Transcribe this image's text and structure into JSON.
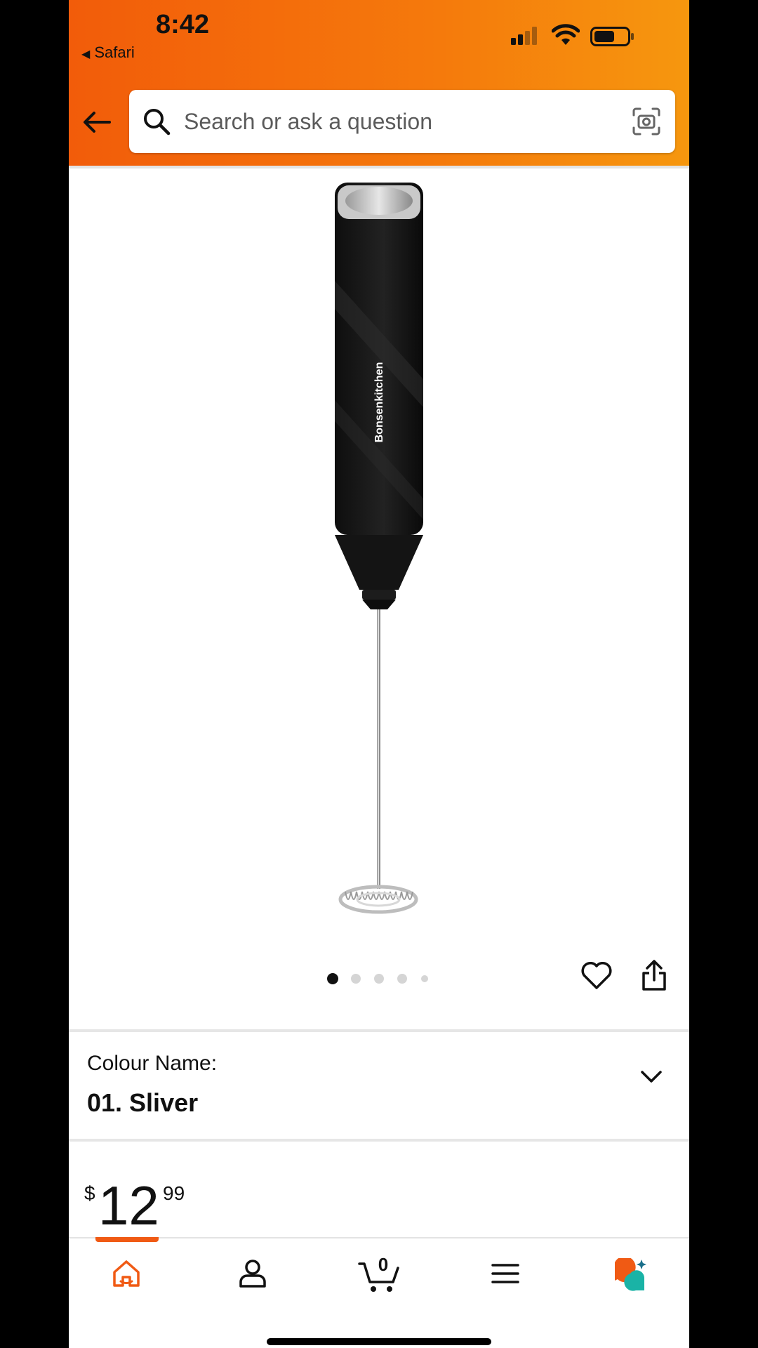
{
  "status_bar": {
    "time": "8:42",
    "back_app": "Safari"
  },
  "search": {
    "placeholder": "Search or ask a question"
  },
  "product": {
    "brand_print": "Bonsenkitchen"
  },
  "carousel": {
    "count": 5,
    "active_index": 0
  },
  "variant": {
    "label": "Colour Name:",
    "value": "01. Sliver"
  },
  "price": {
    "symbol": "$",
    "whole": "12",
    "fraction": "99"
  },
  "bottom_nav": {
    "items": [
      "home-icon",
      "account-icon",
      "cart-icon",
      "menu-icon",
      "rufus-icon"
    ],
    "cart_count": "0",
    "active": "home"
  },
  "colors": {
    "accent": "#f05a14",
    "header_start": "#f25c0a",
    "header_end": "#f6970e",
    "rufus_teal": "#1ab3a6"
  }
}
